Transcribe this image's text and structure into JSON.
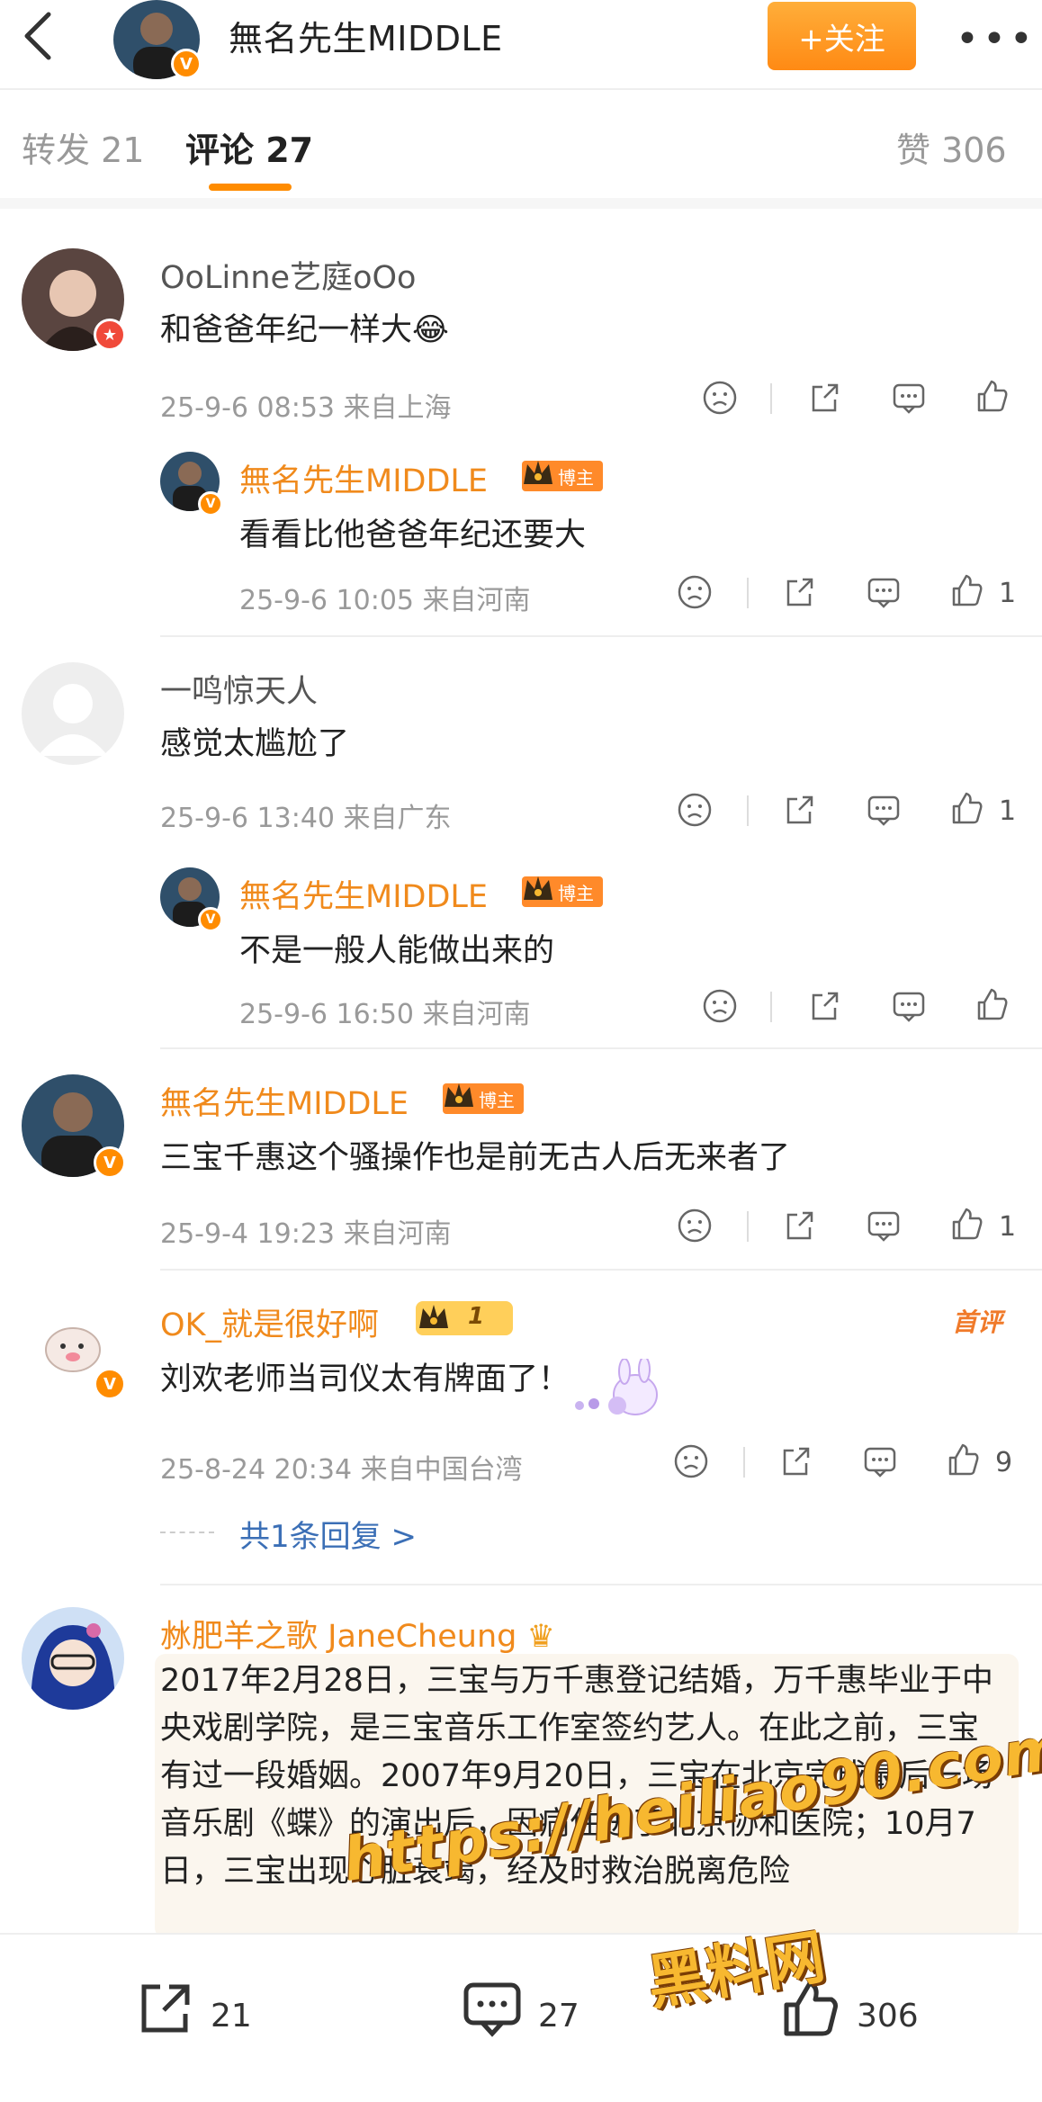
{
  "header": {
    "title": "無名先生MIDDLE",
    "follow_label": "+关注",
    "more_label": "•••"
  },
  "tabs": {
    "repost": "转发 21",
    "comments": "评论 27",
    "likes": "赞 306"
  },
  "comments": [
    {
      "user": "OoLinne艺庭oOo",
      "text": "和爸爸年纪一样大",
      "meta": "25-9-6 08:53 来自上海",
      "likes": "",
      "reply": {
        "user": "無名先生MIDDLE",
        "tag": "博主",
        "text": "看看比他爸爸年纪还要大",
        "meta": "25-9-6 10:05 来自河南",
        "likes": "1"
      }
    },
    {
      "user": "一鸣惊天人",
      "text": "感觉太尴尬了",
      "meta": "25-9-6 13:40 来自广东",
      "likes": "1",
      "reply": {
        "user": "無名先生MIDDLE",
        "tag": "博主",
        "text": "不是一般人能做出来的",
        "meta": "25-9-6 16:50 来自河南",
        "likes": ""
      }
    },
    {
      "user": "無名先生MIDDLE",
      "tag": "博主",
      "text": "三宝千惠这个骚操作也是前无古人后无来者了",
      "meta": "25-9-4 19:23 来自河南",
      "likes": "1"
    },
    {
      "user": "OK_就是很好啊",
      "level": "1",
      "first_tag": "首评",
      "text": "刘欢老师当司仪太有牌面了！",
      "meta": "25-8-24 20:34 来自中国台湾",
      "likes": "9",
      "reply_link": "共1条回复 >"
    },
    {
      "user": "沝肥羊之歌 JaneCheung",
      "text": "2017年2月28日，三宝与万千惠登记结婚，万千惠毕业于中央戏剧学院，是三宝音乐工作室签约艺人。在此之前，三宝有过一段婚姻。2007年9月20日，三宝在北京完成最后一场音乐剧《蝶》的演出后，因病住进了北京协和医院；10月7日，三宝出现心脏衰竭，经及时救治脱离危险"
    }
  ],
  "bottom_bar": {
    "repost_count": "21",
    "comment_count": "27",
    "like_count": "306"
  },
  "watermark": {
    "url": "https://heiliao90.com",
    "name": "黑料网"
  },
  "colors": {
    "accent": "#ff8c00",
    "vip_name": "#f08a1c",
    "link": "#3b6fb6"
  }
}
